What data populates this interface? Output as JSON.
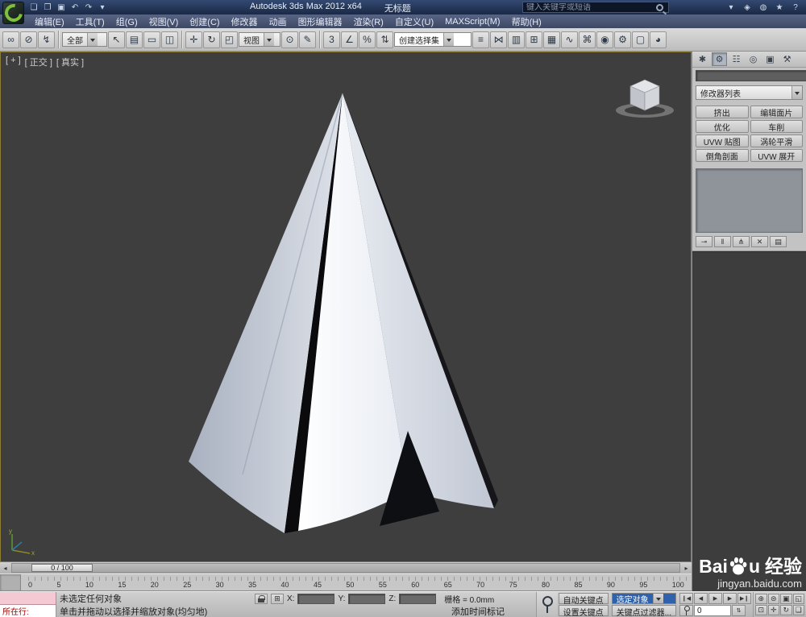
{
  "colors": {
    "titlebar": "#1f3052",
    "menubar": "#4a5674",
    "viewport_bg": "#3e3e3e",
    "panel_bg": "#c3c3c3",
    "active_viewport_border": "#8e7d35",
    "selection_blue": "#2f62ad",
    "logo_green": "#7ec13e"
  },
  "window": {
    "product_title": "Autodesk 3ds Max 2012 x64",
    "document_title": "无标题",
    "search_placeholder": "键入关键字或短语",
    "quick_access": [
      {
        "name": "new-scene-icon",
        "glyph": "❏"
      },
      {
        "name": "open-file-icon",
        "glyph": "❐"
      },
      {
        "name": "save-file-icon",
        "glyph": "▣"
      },
      {
        "name": "undo-icon",
        "glyph": "↶"
      },
      {
        "name": "redo-icon",
        "glyph": "↷"
      },
      {
        "name": "quick-access-dropdown-icon",
        "glyph": "▾"
      }
    ],
    "infocenter": [
      {
        "name": "search-history-dropdown-icon",
        "glyph": "▾"
      },
      {
        "name": "subscription-center-icon",
        "glyph": "◈"
      },
      {
        "name": "communication-center-icon",
        "glyph": "◍"
      },
      {
        "name": "favorites-icon",
        "glyph": "★"
      },
      {
        "name": "help-icon",
        "glyph": "?"
      }
    ]
  },
  "menubar": [
    {
      "name": "menu-edit",
      "label": "编辑(E)"
    },
    {
      "name": "menu-tools",
      "label": "工具(T)"
    },
    {
      "name": "menu-group",
      "label": "组(G)"
    },
    {
      "name": "menu-views",
      "label": "视图(V)"
    },
    {
      "name": "menu-create",
      "label": "创建(C)"
    },
    {
      "name": "menu-modifiers",
      "label": "修改器"
    },
    {
      "name": "menu-animation",
      "label": "动画"
    },
    {
      "name": "menu-graph-editors",
      "label": "图形编辑器"
    },
    {
      "name": "menu-rendering",
      "label": "渲染(R)"
    },
    {
      "name": "menu-customize",
      "label": "自定义(U)"
    },
    {
      "name": "menu-maxscript",
      "label": "MAXScript(M)"
    },
    {
      "name": "menu-help",
      "label": "帮助(H)"
    }
  ],
  "toolbar": {
    "selection_filter_value": "全部",
    "reference_coordinate_value": "视图",
    "named_selection_value": "创建选择集",
    "groups": {
      "link": [
        {
          "name": "select-and-link-icon",
          "glyph": "∞"
        },
        {
          "name": "unlink-selection-icon",
          "glyph": "⊘"
        },
        {
          "name": "bind-to-space-warp-icon",
          "glyph": "↯"
        }
      ],
      "selection": [
        {
          "name": "select-object-icon",
          "glyph": "↖"
        },
        {
          "name": "select-by-name-icon",
          "glyph": "▤"
        },
        {
          "name": "selection-region-icon",
          "glyph": "▭"
        },
        {
          "name": "window-crossing-icon",
          "glyph": "◫"
        }
      ],
      "transform": [
        {
          "name": "select-and-move-icon",
          "glyph": "✛"
        },
        {
          "name": "select-and-rotate-icon",
          "glyph": "↻"
        },
        {
          "name": "select-and-scale-icon",
          "glyph": "◰"
        }
      ],
      "center": [
        {
          "name": "use-pivot-center-icon",
          "glyph": "⊙"
        },
        {
          "name": "select-and-manipulate-icon",
          "glyph": "✎"
        }
      ],
      "snaps": [
        {
          "name": "snaps-toggle-icon",
          "glyph": "3"
        },
        {
          "name": "angle-snap-icon",
          "glyph": "∠"
        },
        {
          "name": "percent-snap-icon",
          "glyph": "%"
        },
        {
          "name": "spinner-snap-icon",
          "glyph": "⇅"
        }
      ],
      "tools": [
        {
          "name": "edit-named-selection-sets-icon",
          "glyph": "≡"
        },
        {
          "name": "mirror-icon",
          "glyph": "⋈"
        },
        {
          "name": "align-icon",
          "glyph": "▥"
        },
        {
          "name": "layer-manager-icon",
          "glyph": "⊞"
        },
        {
          "name": "graphite-ribbon-icon",
          "glyph": "▦"
        },
        {
          "name": "curve-editor-icon",
          "glyph": "∿"
        },
        {
          "name": "schematic-view-icon",
          "glyph": "⌘"
        },
        {
          "name": "material-editor-icon",
          "glyph": "◉"
        },
        {
          "name": "render-setup-icon",
          "glyph": "⚙"
        },
        {
          "name": "rendered-frame-icon",
          "glyph": "▢"
        },
        {
          "name": "render-production-icon",
          "glyph": "◕"
        }
      ]
    }
  },
  "viewport": {
    "label_general": "[ + ]",
    "label_view": "[ 正交 ]",
    "label_shading": "[ 真实 ]"
  },
  "command_panel": {
    "object_name_value": "",
    "modifier_list_label": "修改器列表",
    "tabs": [
      {
        "name": "tab-create",
        "glyph": "✱"
      },
      {
        "name": "tab-modify",
        "glyph": "⚙"
      },
      {
        "name": "tab-hierarchy",
        "glyph": "☷"
      },
      {
        "name": "tab-motion",
        "glyph": "◎"
      },
      {
        "name": "tab-display",
        "glyph": "▣"
      },
      {
        "name": "tab-utilities",
        "glyph": "⚒"
      }
    ],
    "modifier_buttons": [
      {
        "name": "modifier-extrude-button",
        "label": "挤出"
      },
      {
        "name": "modifier-edit-patch-button",
        "label": "编辑面片"
      },
      {
        "name": "modifier-optimize-button",
        "label": "优化"
      },
      {
        "name": "modifier-lathe-button",
        "label": "车削"
      },
      {
        "name": "modifier-uvw-map-button",
        "label": "UVW 贴图"
      },
      {
        "name": "modifier-turbosmooth-button",
        "label": "涡轮平滑"
      },
      {
        "name": "modifier-bevel-profile-button",
        "label": "倒角剖面"
      },
      {
        "name": "modifier-unwrap-uvw-button",
        "label": "UVW 展开"
      }
    ],
    "stack_tools": [
      {
        "name": "pin-stack-icon",
        "glyph": "⊸"
      },
      {
        "name": "show-end-result-icon",
        "glyph": "‖"
      },
      {
        "name": "make-unique-icon",
        "glyph": "⋔"
      },
      {
        "name": "remove-modifier-icon",
        "glyph": "✕"
      },
      {
        "name": "configure-modifier-sets-icon",
        "glyph": "▤"
      }
    ]
  },
  "timeline": {
    "slider_value": "0 / 100",
    "ticks": [
      "0",
      "5",
      "10",
      "15",
      "20",
      "25",
      "30",
      "35",
      "40",
      "45",
      "50",
      "55",
      "60",
      "65",
      "70",
      "75",
      "80",
      "85",
      "90",
      "95",
      "100"
    ]
  },
  "status": {
    "listener_label": "所在行:",
    "status_line": "未选定任何对象",
    "prompt_line": "单击并拖动以选择并缩放对象(均匀地)",
    "x_label": "X:",
    "y_label": "Y:",
    "z_label": "Z:",
    "grid_label": "栅格 = 0.0mm",
    "add_time_tag": "添加时间标记",
    "auto_key_label": "自动关键点",
    "set_key_label": "设置关键点",
    "key_mode_value": "选定对象",
    "key_filters_label": "关键点过滤器...",
    "frame_value": "0",
    "abs_mode_glyph": "⊞",
    "frame_spinner_glyph": "⇅",
    "transport": [
      {
        "name": "go-to-start-icon",
        "glyph": "❙◀"
      },
      {
        "name": "previous-frame-icon",
        "glyph": "◀"
      },
      {
        "name": "play-animation-icon",
        "glyph": "▶"
      },
      {
        "name": "next-frame-icon",
        "glyph": "▶"
      },
      {
        "name": "go-to-end-icon",
        "glyph": "▶❙"
      }
    ],
    "nav": [
      {
        "name": "zoom-icon",
        "glyph": "⊕"
      },
      {
        "name": "zoom-all-icon",
        "glyph": "⊜"
      },
      {
        "name": "zoom-extents-icon",
        "glyph": "▣"
      },
      {
        "name": "zoom-extents-all-icon",
        "glyph": "◱"
      },
      {
        "name": "zoom-region-icon",
        "glyph": "⊡"
      },
      {
        "name": "pan-icon",
        "glyph": "✛"
      },
      {
        "name": "orbit-icon",
        "glyph": "↻"
      },
      {
        "name": "maximize-viewport-icon",
        "glyph": "❏"
      }
    ]
  },
  "watermark": {
    "brand_prefix": "Bai",
    "brand_suffix": "u",
    "brand_cn": "经验",
    "site": "jingyan.baidu.com"
  }
}
